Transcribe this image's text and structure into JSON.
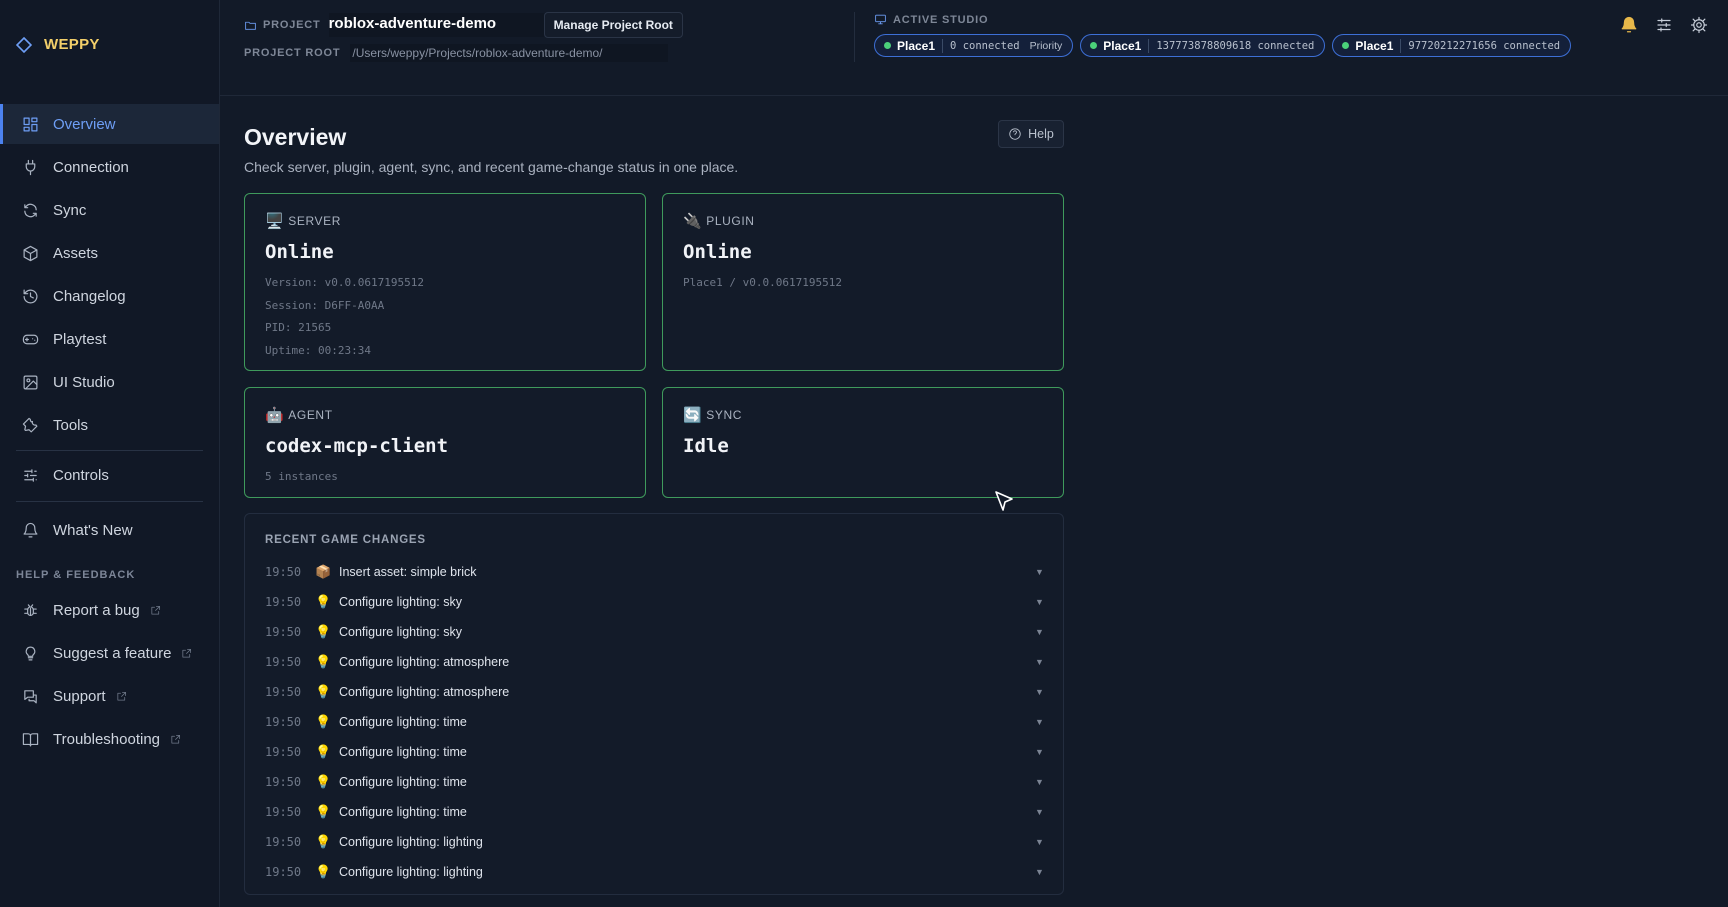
{
  "brand": {
    "name": "WEPPY",
    "logo_icon": "diamond-icon"
  },
  "sidebar": {
    "items": [
      {
        "label": "Overview",
        "icon": "grid-icon",
        "active": true
      },
      {
        "label": "Connection",
        "icon": "plug-icon"
      },
      {
        "label": "Sync",
        "icon": "refresh-icon"
      },
      {
        "label": "Assets",
        "icon": "box-icon"
      },
      {
        "label": "Changelog",
        "icon": "history-icon"
      },
      {
        "label": "Playtest",
        "icon": "gamepad-icon"
      },
      {
        "label": "UI Studio",
        "icon": "image-icon"
      },
      {
        "label": "Tools",
        "icon": "wrench-icon"
      },
      {
        "label": "Controls",
        "icon": "sliders-icon"
      },
      {
        "label": "What's New",
        "icon": "bell-icon"
      }
    ],
    "help_section_label": "HELP & FEEDBACK",
    "help_items": [
      {
        "label": "Report a bug",
        "icon": "bug-icon"
      },
      {
        "label": "Suggest a feature",
        "icon": "lightbulb-icon"
      },
      {
        "label": "Support",
        "icon": "chat-icon"
      },
      {
        "label": "Troubleshooting",
        "icon": "book-icon"
      }
    ]
  },
  "topbar": {
    "project_label": "PROJECT",
    "project_name": "roblox-adventure-demo",
    "manage_button": "Manage Project Root",
    "root_label": "PROJECT ROOT",
    "root_path": "/Users/weppy/Projects/roblox-adventure-demo/",
    "studio_label": "ACTIVE STUDIO",
    "studios": [
      {
        "name": "Place1",
        "meta": "0 connected",
        "extra": "Priority"
      },
      {
        "name": "Place1",
        "meta": "137773878809618 connected",
        "extra": ""
      },
      {
        "name": "Place1",
        "meta": "97720212271656 connected",
        "extra": ""
      }
    ]
  },
  "main": {
    "title": "Overview",
    "subtitle": "Check server, plugin, agent, sync, and recent game-change status in one place.",
    "help_label": "Help",
    "server": {
      "emoji": "🖥️",
      "label": "SERVER",
      "status": "Online",
      "version": "Version: v0.0.0617195512",
      "session": "Session: D6FF-A0AA",
      "pid": "PID: 21565",
      "uptime": "Uptime: 00:23:34"
    },
    "plugin": {
      "emoji": "🔌",
      "label": "PLUGIN",
      "status": "Online",
      "meta": "Place1 / v0.0.0617195512"
    },
    "agent": {
      "emoji": "🤖",
      "label": "AGENT",
      "status": "codex-mcp-client",
      "meta": "5 instances"
    },
    "sync": {
      "emoji": "🔄",
      "label": "SYNC",
      "status": "Idle"
    },
    "recent_title": "RECENT GAME CHANGES",
    "changes": [
      {
        "time": "19:50",
        "emoji": "📦",
        "desc": "Insert asset: simple brick"
      },
      {
        "time": "19:50",
        "emoji": "💡",
        "desc": "Configure lighting: sky"
      },
      {
        "time": "19:50",
        "emoji": "💡",
        "desc": "Configure lighting: sky"
      },
      {
        "time": "19:50",
        "emoji": "💡",
        "desc": "Configure lighting: atmosphere"
      },
      {
        "time": "19:50",
        "emoji": "💡",
        "desc": "Configure lighting: atmosphere"
      },
      {
        "time": "19:50",
        "emoji": "💡",
        "desc": "Configure lighting: time"
      },
      {
        "time": "19:50",
        "emoji": "💡",
        "desc": "Configure lighting: time"
      },
      {
        "time": "19:50",
        "emoji": "💡",
        "desc": "Configure lighting: time"
      },
      {
        "time": "19:50",
        "emoji": "💡",
        "desc": "Configure lighting: time"
      },
      {
        "time": "19:50",
        "emoji": "💡",
        "desc": "Configure lighting: lighting"
      },
      {
        "time": "19:50",
        "emoji": "💡",
        "desc": "Configure lighting: lighting"
      }
    ]
  },
  "colors": {
    "accent": "#4c82ef",
    "online_border": "#3f9a5c",
    "brand": "#f3cf6a",
    "status_dot": "#4bd07a"
  }
}
